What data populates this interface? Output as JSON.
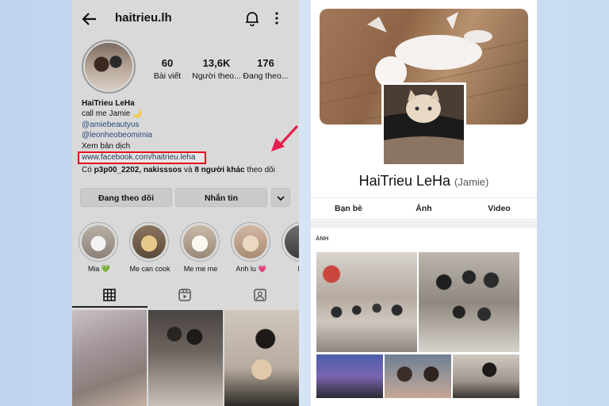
{
  "instagram": {
    "username": "haitrieu.lh",
    "stats": [
      {
        "value": "60",
        "label": "Bài viết"
      },
      {
        "value": "13,6K",
        "label": "Người theo..."
      },
      {
        "value": "176",
        "label": "Đang theo..."
      }
    ],
    "bio": {
      "name": "HaiTrieu LeHa",
      "tagline": "call me Jamie 🌙",
      "mentions": [
        "@amiebeautyus",
        "@leonheobeomimia"
      ],
      "translate": "Xem bản dịch",
      "link": "www.facebook.com/haitrieu.leha",
      "followed_by_prefix": "Có ",
      "followed_by_users": "p3p00_2202, nakisssos",
      "followed_by_and": " và ",
      "followed_by_others": "8 người khác",
      "followed_by_suffix": " theo dõi"
    },
    "buttons": {
      "following": "Đang theo dõi",
      "message": "Nhắn tin",
      "dropdown_icon": "chevron-down-icon"
    },
    "highlights": [
      {
        "label": "Mia",
        "emoji": "💚"
      },
      {
        "label": "Me can cook",
        "emoji": ""
      },
      {
        "label": "Me me me",
        "emoji": ""
      },
      {
        "label": "Anh lu",
        "emoji": "💗"
      },
      {
        "label": "Be",
        "emoji": ""
      }
    ],
    "tabs": [
      "grid-icon",
      "reels-icon",
      "tagged-icon"
    ],
    "colors": {
      "highlight_box": "#e3101d",
      "arrow": "#e61e50",
      "link": "#1d2f55"
    }
  },
  "facebook": {
    "name": "HaiTrieu LeHa",
    "alt_name": "(Jamie)",
    "tabs": [
      "Bạn bè",
      "Ảnh",
      "Video"
    ],
    "photos_section": "ẢNH"
  }
}
